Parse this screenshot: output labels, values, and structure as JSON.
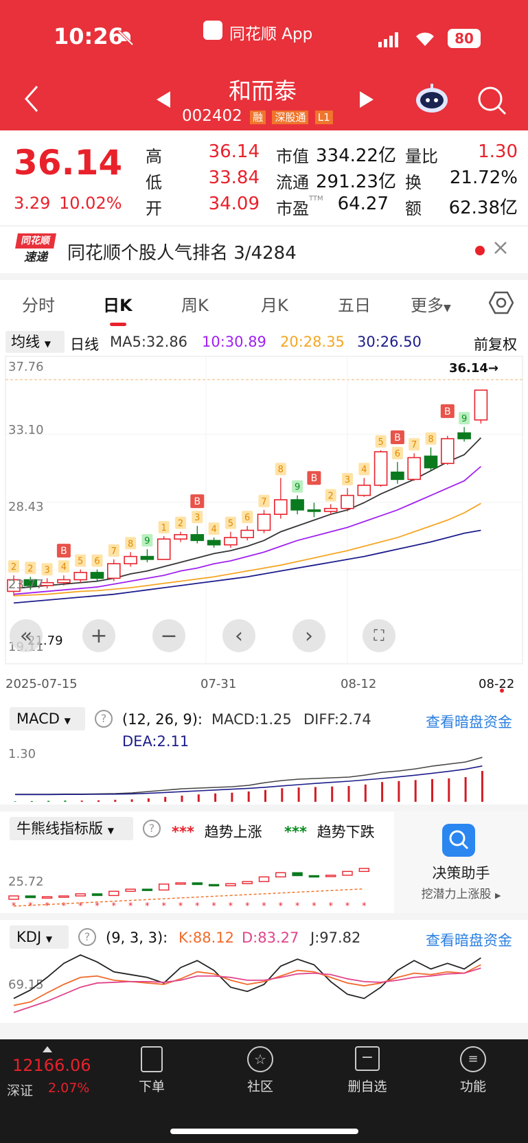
{
  "status_bar": {
    "time": "10:26",
    "app_name": "同花顺 App",
    "battery": "80"
  },
  "header": {
    "stock_name": "和而泰",
    "stock_code": "002402",
    "badges": [
      "融",
      "深股通",
      "L1"
    ]
  },
  "quote": {
    "price": "36.14",
    "change": "3.29",
    "change_pct": "10.02%",
    "fields": [
      {
        "label": "高",
        "value": "36.14"
      },
      {
        "label": "低",
        "value": "33.84"
      },
      {
        "label": "开",
        "value": "34.09"
      },
      {
        "label": "市值",
        "value": "334.22亿"
      },
      {
        "label": "流通",
        "value": "291.23亿"
      },
      {
        "label": "市盈",
        "sup": "TTM",
        "value": "64.27"
      },
      {
        "label": "量比",
        "value": "1.30"
      },
      {
        "label": "换",
        "value": "21.72%"
      },
      {
        "label": "额",
        "value": "62.38亿"
      }
    ]
  },
  "news_bar": {
    "logo_top": "同花顺",
    "logo_bottom": "速递",
    "text": "同花顺个股人气排名 3/4284"
  },
  "tabs": [
    "分时",
    "日K",
    "周K",
    "月K",
    "五日",
    "更多"
  ],
  "active_tab": "日K",
  "ma_bar": {
    "selector": "均线",
    "period": "日线",
    "ma5": "MA5:32.86",
    "ma10": "10:30.89",
    "ma20": "20:28.35",
    "ma30": "30:26.50",
    "adjust": "前复权"
  },
  "kchart": {
    "y_labels": [
      "37.76",
      "33.10",
      "28.43",
      "23.77",
      "19.11"
    ],
    "last_price_label": "36.14→",
    "min_label": "21.79",
    "x_labels": [
      "2025-07-15",
      "07-31",
      "08-12",
      "08-22"
    ],
    "colors": {
      "up": "#e8212b",
      "down": "#0a7a1f",
      "ma5": "#333333",
      "ma10": "#a020f0",
      "ma20": "#f5a623",
      "ma30": "#1c1c8c"
    }
  },
  "chart_data": {
    "type": "candlestick",
    "title": "",
    "ylim": [
      19.11,
      37.76
    ],
    "candles": [
      {
        "o": 22.3,
        "c": 23.1,
        "h": 23.4,
        "l": 22.0
      },
      {
        "o": 23.1,
        "c": 22.7,
        "h": 23.3,
        "l": 22.4
      },
      {
        "o": 22.7,
        "c": 22.9,
        "h": 23.2,
        "l": 22.5
      },
      {
        "o": 22.9,
        "c": 23.1,
        "h": 23.4,
        "l": 22.7
      },
      {
        "o": 23.1,
        "c": 23.6,
        "h": 23.8,
        "l": 22.9
      },
      {
        "o": 23.6,
        "c": 23.2,
        "h": 23.8,
        "l": 23.0
      },
      {
        "o": 23.2,
        "c": 24.2,
        "h": 24.5,
        "l": 23.0
      },
      {
        "o": 24.2,
        "c": 24.7,
        "h": 25.0,
        "l": 24.0
      },
      {
        "o": 24.7,
        "c": 24.5,
        "h": 25.2,
        "l": 24.3
      },
      {
        "o": 24.5,
        "c": 25.9,
        "h": 26.1,
        "l": 24.5
      },
      {
        "o": 25.9,
        "c": 26.2,
        "h": 26.4,
        "l": 25.7
      },
      {
        "o": 26.2,
        "c": 25.8,
        "h": 26.8,
        "l": 25.6
      },
      {
        "o": 25.8,
        "c": 25.5,
        "h": 26.0,
        "l": 25.3
      },
      {
        "o": 25.5,
        "c": 26.0,
        "h": 26.4,
        "l": 25.3
      },
      {
        "o": 26.0,
        "c": 26.5,
        "h": 26.8,
        "l": 25.8
      },
      {
        "o": 26.5,
        "c": 27.6,
        "h": 27.9,
        "l": 26.3
      },
      {
        "o": 27.6,
        "c": 28.6,
        "h": 30.1,
        "l": 27.3
      },
      {
        "o": 28.6,
        "c": 27.9,
        "h": 28.9,
        "l": 27.6
      },
      {
        "o": 27.9,
        "c": 27.8,
        "h": 28.4,
        "l": 27.4
      },
      {
        "o": 27.8,
        "c": 28.0,
        "h": 28.3,
        "l": 27.6
      },
      {
        "o": 28.0,
        "c": 28.9,
        "h": 29.4,
        "l": 27.8
      },
      {
        "o": 28.9,
        "c": 29.6,
        "h": 30.1,
        "l": 28.8
      },
      {
        "o": 29.6,
        "c": 31.9,
        "h": 32.0,
        "l": 29.5
      },
      {
        "o": 30.5,
        "c": 30.0,
        "h": 31.2,
        "l": 29.7
      },
      {
        "o": 30.0,
        "c": 31.5,
        "h": 31.8,
        "l": 29.9
      },
      {
        "o": 31.6,
        "c": 30.8,
        "h": 32.2,
        "l": 30.6
      },
      {
        "o": 31.1,
        "c": 32.8,
        "h": 33.0,
        "l": 31.0
      },
      {
        "o": 33.2,
        "c": 32.8,
        "h": 33.6,
        "l": 32.6
      },
      {
        "o": 34.09,
        "c": 36.14,
        "h": 36.14,
        "l": 33.84
      }
    ],
    "ma_series": [
      {
        "name": "MA5",
        "values": [
          22.5,
          22.6,
          22.7,
          22.8,
          22.9,
          23.0,
          23.2,
          23.5,
          23.7,
          24.0,
          24.3,
          24.6,
          24.9,
          25.1,
          25.4,
          25.8,
          26.4,
          26.8,
          27.2,
          27.6,
          27.9,
          28.4,
          29.0,
          29.5,
          30.0,
          30.6,
          31.2,
          31.7,
          32.86
        ]
      },
      {
        "name": "MA10",
        "values": [
          22.1,
          22.2,
          22.3,
          22.4,
          22.5,
          22.6,
          22.8,
          23.0,
          23.2,
          23.4,
          23.7,
          23.9,
          24.2,
          24.4,
          24.7,
          25.0,
          25.4,
          25.8,
          26.1,
          26.4,
          26.7,
          27.1,
          27.5,
          27.9,
          28.4,
          28.9,
          29.4,
          29.9,
          30.89
        ]
      },
      {
        "name": "MA20",
        "values": [
          22.0,
          22.05,
          22.1,
          22.2,
          22.3,
          22.35,
          22.45,
          22.55,
          22.7,
          22.85,
          23.0,
          23.15,
          23.3,
          23.5,
          23.7,
          23.9,
          24.1,
          24.35,
          24.6,
          24.85,
          25.1,
          25.4,
          25.7,
          26.0,
          26.4,
          26.8,
          27.2,
          27.7,
          28.35
        ]
      },
      {
        "name": "MA30",
        "values": [
          21.5,
          21.6,
          21.7,
          21.8,
          21.9,
          22.0,
          22.1,
          22.25,
          22.4,
          22.55,
          22.7,
          22.85,
          23.0,
          23.15,
          23.3,
          23.5,
          23.7,
          23.9,
          24.1,
          24.3,
          24.5,
          24.7,
          24.95,
          25.2,
          25.45,
          25.7,
          26.0,
          26.3,
          26.5
        ]
      }
    ],
    "markers": [
      {
        "i": 0,
        "t": "2"
      },
      {
        "i": 1,
        "t": "2"
      },
      {
        "i": 2,
        "t": "3"
      },
      {
        "i": 3,
        "t": "4"
      },
      {
        "i": 4,
        "t": "5"
      },
      {
        "i": 5,
        "t": "6"
      },
      {
        "i": 6,
        "t": "7"
      },
      {
        "i": 7,
        "t": "8"
      },
      {
        "i": 8,
        "t": "9"
      },
      {
        "i": 9,
        "t": "1"
      },
      {
        "i": 10,
        "t": "2"
      },
      {
        "i": 11,
        "t": "3"
      },
      {
        "i": 12,
        "t": "4"
      },
      {
        "i": 13,
        "t": "5"
      },
      {
        "i": 14,
        "t": "6"
      },
      {
        "i": 15,
        "t": "7"
      },
      {
        "i": 16,
        "t": "8"
      },
      {
        "i": 17,
        "t": "9"
      },
      {
        "i": 19,
        "t": "2"
      },
      {
        "i": 20,
        "t": "3"
      },
      {
        "i": 21,
        "t": "4"
      },
      {
        "i": 22,
        "t": "5"
      },
      {
        "i": 23,
        "t": "6"
      },
      {
        "i": 24,
        "t": "7"
      },
      {
        "i": 25,
        "t": "8"
      },
      {
        "i": 27,
        "t": "9"
      }
    ],
    "bs_labels": [
      {
        "i": 3,
        "t": "B"
      },
      {
        "i": 11,
        "t": "B"
      },
      {
        "i": 18,
        "t": "B"
      },
      {
        "i": 23,
        "t": "B"
      },
      {
        "i": 26,
        "t": "B"
      }
    ]
  },
  "macd": {
    "selector": "MACD",
    "params": "(12, 26, 9):",
    "macd": "MACD:1.25",
    "diff": "DIFF:2.74",
    "dea": "DEA:2.11",
    "y_label": "1.30",
    "link": "查看暗盘资金",
    "bars": [
      0.02,
      0.03,
      0.04,
      0.05,
      0.05,
      0.06,
      0.08,
      0.1,
      0.14,
      0.2,
      0.25,
      0.3,
      0.34,
      0.37,
      0.42,
      0.48,
      0.55,
      0.58,
      0.6,
      0.62,
      0.64,
      0.7,
      0.8,
      0.84,
      0.88,
      0.92,
      0.95,
      1.0,
      1.25
    ]
  },
  "bull_bear": {
    "selector": "牛熊线指标版",
    "up_label": "趋势上涨",
    "down_label": "趋势下跌",
    "y_label": "25.72",
    "assistant_title": "决策助手",
    "assistant_sub": "挖潜力上涨股"
  },
  "kdj": {
    "selector": "KDJ",
    "params": "(9, 3, 3):",
    "k": "K:88.12",
    "d": "D:83.27",
    "j": "J:97.82",
    "y_label": "69.15",
    "link": "查看暗盘资金",
    "k_values": [
      30,
      35,
      48,
      60,
      70,
      72,
      66,
      64,
      62,
      60,
      68,
      78,
      75,
      66,
      60,
      64,
      72,
      80,
      78,
      70,
      62,
      58,
      62,
      70,
      76,
      74,
      78,
      76,
      88.12
    ],
    "d_values": [
      20,
      28,
      36,
      46,
      56,
      62,
      63,
      64,
      64,
      63,
      66,
      72,
      72,
      70,
      66,
      66,
      70,
      75,
      76,
      74,
      68,
      64,
      63,
      66,
      70,
      72,
      75,
      76,
      83.27
    ],
    "j_values": [
      40,
      52,
      70,
      90,
      102,
      92,
      78,
      74,
      70,
      62,
      84,
      94,
      80,
      56,
      50,
      60,
      86,
      96,
      88,
      64,
      46,
      40,
      56,
      80,
      94,
      82,
      90,
      82,
      97.82
    ]
  },
  "bottom_bar": {
    "index_value": "12166.06",
    "index_name": "深证",
    "index_change": "2.07%",
    "items": [
      {
        "label": "下单",
        "icon": "order-icon"
      },
      {
        "label": "社区",
        "icon": "community-icon"
      },
      {
        "label": "删自选",
        "icon": "remove-watchlist-icon"
      },
      {
        "label": "功能",
        "icon": "menu-icon"
      }
    ]
  }
}
